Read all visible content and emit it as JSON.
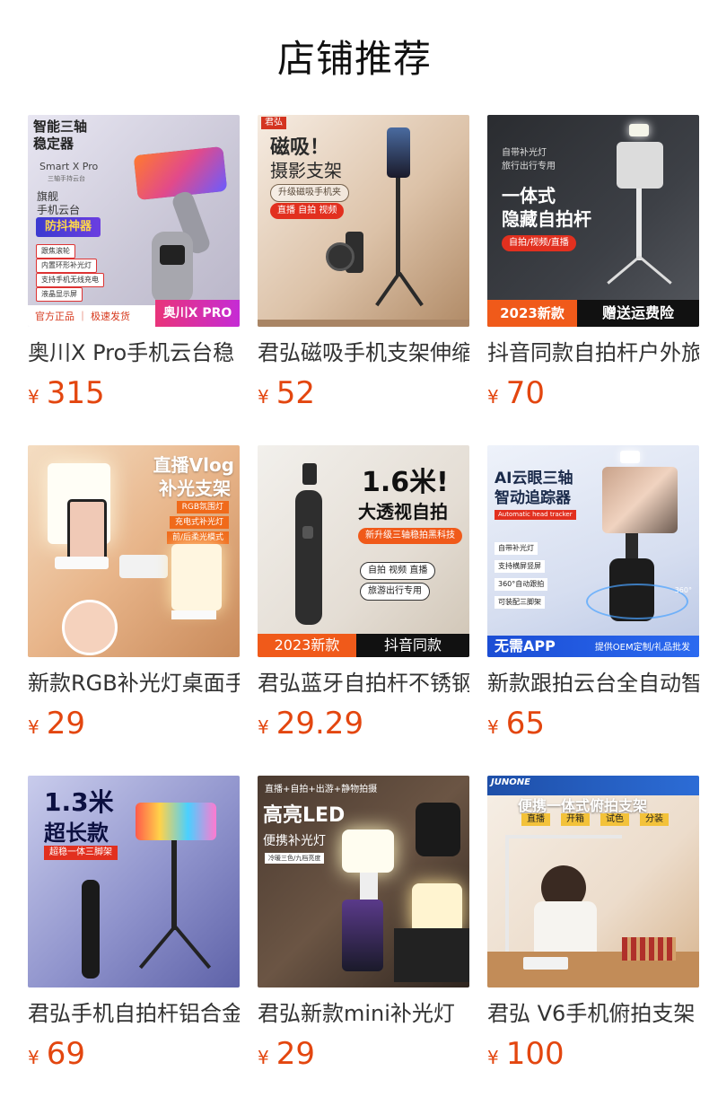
{
  "section_title": "店铺推荐",
  "currency": "¥",
  "products": [
    {
      "name": "奥川X Pro手机云台稳",
      "price": "315",
      "image": {
        "h1": "智能三轴",
        "h2": "稳定器",
        "sub": "Smart X Pro",
        "sub2": "三轴手持云台",
        "l1": "旗舰",
        "l2": "手机云台",
        "badge": "防抖神器",
        "features": [
          "跟焦滚轮",
          "内置环形补光灯",
          "支持手机无线充电",
          "液晶显示屏"
        ],
        "footer_left": "官方正品 ｜ 极速发货",
        "footer_right": "奥川X PRO"
      }
    },
    {
      "name": "君弘磁吸手机支架伸缩",
      "price": "52",
      "image": {
        "corner": "君弘",
        "h1": "磁吸！",
        "h2": "摄影支架",
        "tag1": "升级磁吸手机夹",
        "tag2": "直播 自拍 视频"
      }
    },
    {
      "name": "抖音同款自拍杆户外旅",
      "price": "70",
      "image": {
        "s1": "自带补光灯",
        "s2": "旅行出行专用",
        "h1": "一体式",
        "h2": "隐藏自拍杆",
        "tag": "自拍/视频/直播",
        "footer_left": "2023新款",
        "footer_right": "赠送运费险"
      }
    },
    {
      "name": "新款RGB补光灯桌面手",
      "price": "29",
      "image": {
        "h1": "直播Vlog",
        "h2": "补光支架",
        "tags": [
          "RGB氛围灯",
          "充电式补光灯",
          "前/后柔光模式"
        ]
      }
    },
    {
      "name": "君弘蓝牙自拍杆不锈钢",
      "price": "29.29",
      "image": {
        "h1": "1.6米!",
        "h2": "大透视自拍",
        "tag": "新升级三轴稳拍黑科技",
        "b1": "自拍 视频 直播",
        "b2": "旅游出行专用",
        "footer_left": "2023新款",
        "footer_right": "抖音同款"
      }
    },
    {
      "name": "新款跟拍云台全自动智",
      "price": "65",
      "image": {
        "h1": "AI云眼三轴",
        "h2": "智动追踪器",
        "tag": "Automatic head tracker",
        "features": [
          "自带补光灯",
          "支持横屏竖屏",
          "360°自动跟拍",
          "可装配三脚架"
        ],
        "deg": "360°",
        "footer_left": "无需APP",
        "footer_right": "提供OEM定制/礼品批发"
      }
    },
    {
      "name": "君弘手机自拍杆铝合金",
      "price": "69",
      "image": {
        "h1": "1.3米",
        "h2": "超长款",
        "tag": "超稳一体三脚架"
      }
    },
    {
      "name": "君弘新款mini补光灯",
      "price": "29",
      "image": {
        "s1": "直播+自拍+出游+静物拍摄",
        "h1": "高亮LED",
        "h2": "便携补光灯",
        "tag": "冷暖三色/九档亮度"
      }
    },
    {
      "name": "君弘 V6手机俯拍支架",
      "price": "100",
      "image": {
        "brand": "JUNONE",
        "h1": "便携一体式俯拍支架",
        "tags": [
          "直播",
          "开箱",
          "试色",
          "分装"
        ]
      }
    }
  ],
  "colors": {
    "price": "#e3460f",
    "accent_orange": "#f05a1a",
    "accent_red": "#e2301f"
  }
}
